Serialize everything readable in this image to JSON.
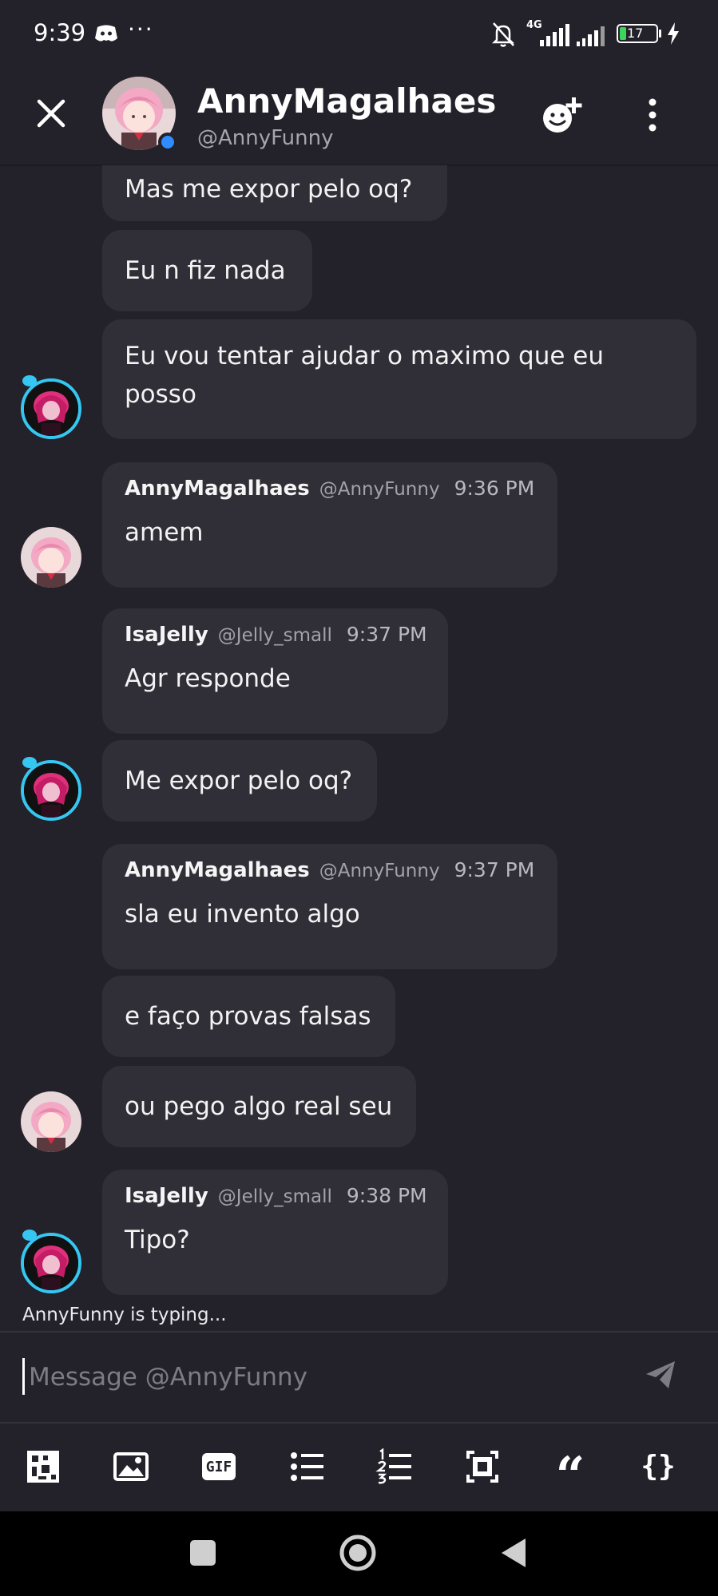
{
  "status_bar": {
    "time": "9:39",
    "ellipsis": "···",
    "network": "4G",
    "battery": "17",
    "icons": [
      "discord-icon",
      "bell-off-icon",
      "signal-icon",
      "battery-icon",
      "charging-icon"
    ]
  },
  "header": {
    "name": "AnnyMagalhaes",
    "handle": "@AnnyFunny",
    "online": true
  },
  "messages": [
    {
      "text": "Mas me expor pelo oq?"
    },
    {
      "text": "Eu n fiz nada"
    },
    {
      "text": "Eu vou tentar ajudar o maximo que eu",
      "text2": "posso"
    },
    {
      "author": "AnnyMagalhaes",
      "handle": "@AnnyFunny",
      "time": "9:36 PM",
      "text": "amem"
    },
    {
      "author": "IsaJelly",
      "handle": "@Jelly_small",
      "time": "9:37 PM",
      "text": "Agr responde"
    },
    {
      "text": "Me expor pelo oq?"
    },
    {
      "author": "AnnyMagalhaes",
      "handle": "@AnnyFunny",
      "time": "9:37 PM",
      "text": "sla eu invento algo"
    },
    {
      "text": "e faço provas falsas"
    },
    {
      "text": "ou pego algo real seu"
    },
    {
      "author": "IsaJelly",
      "handle": "@Jelly_small",
      "time": "9:38 PM",
      "text": "Tipo?"
    }
  ],
  "typing": "AnnyFunny is typing...",
  "composer": {
    "value": "",
    "placeholder": "Message @AnnyFunny"
  },
  "toolbar": {
    "items": [
      "sticker-icon",
      "image-icon",
      "gif-icon",
      "bullet-list-icon",
      "numbered-list-icon",
      "spoiler-icon",
      "quote-icon",
      "code-icon"
    ],
    "gif_label": "GIF",
    "quote_label": "“",
    "code_label": "{}"
  },
  "colors": {
    "background": "#232129",
    "bubble": "#302e36",
    "accent_online": "#2f8cff",
    "avatar_ring": "#35c7f2"
  }
}
